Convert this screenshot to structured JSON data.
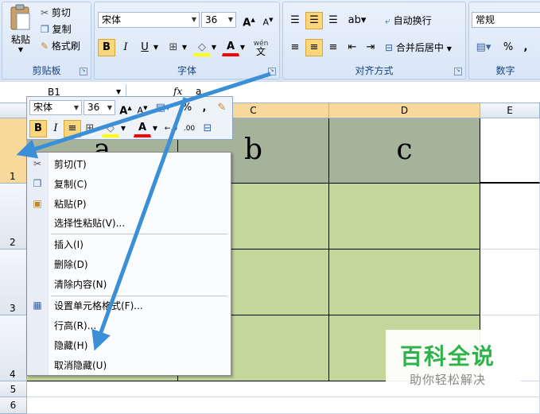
{
  "ribbon": {
    "clipboard": {
      "paste": "粘贴",
      "cut": "剪切",
      "copy": "复制",
      "format_painter": "格式刷",
      "group_label": "剪贴板"
    },
    "font": {
      "name": "宋体",
      "size": "36",
      "group_label": "字体",
      "phonetic": "wén"
    },
    "alignment": {
      "wrap_text": "自动换行",
      "merge_center": "合并后居中",
      "group_label": "对齐方式"
    },
    "number": {
      "format": "常规",
      "percent": "%",
      "comma": ",",
      "group_label": "数字"
    }
  },
  "formula_bar": {
    "name_box": "B1",
    "fx": "fx",
    "content": "a"
  },
  "grid": {
    "columns": [
      "C",
      "D",
      "E"
    ],
    "rows": [
      "1",
      "2",
      "3",
      "4",
      "5",
      "6"
    ],
    "cells": {
      "b1": "a",
      "c1": "b",
      "d1": "c"
    }
  },
  "mini_toolbar": {
    "font": "宋体",
    "size": "36",
    "percent": "%",
    "comma": ","
  },
  "context_menu": {
    "items": [
      "剪切(T)",
      "复制(C)",
      "粘贴(P)",
      "选择性粘贴(V)...",
      "插入(I)",
      "删除(D)",
      "清除内容(N)",
      "设置单元格格式(F)...",
      "行高(R)...",
      "隐藏(H)",
      "取消隐藏(U)"
    ]
  },
  "watermark": {
    "title": "百科全说",
    "subtitle": "助你轻松解决"
  },
  "colors": {
    "accent_arrow": "#3b8fd6",
    "cell_green": "#c4d79b",
    "header_selected": "#a6b39b",
    "watermark_green": "#2db34a"
  }
}
